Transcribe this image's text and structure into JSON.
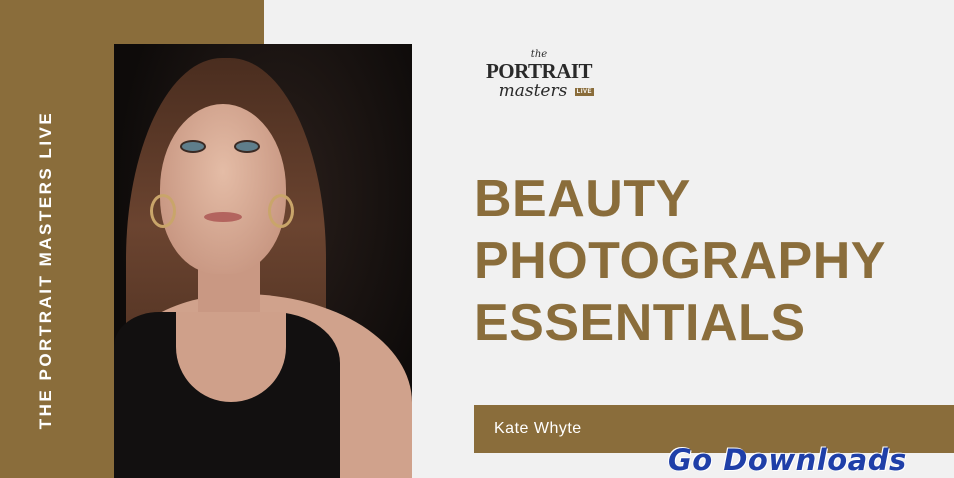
{
  "banner": {
    "vertical_title": "THE PORTRAIT MASTERS LIVE",
    "logo": {
      "the": "the",
      "portrait": "PORTRAIT",
      "masters": "masters",
      "live": "LIVE"
    },
    "headline": [
      "BEAUTY",
      "PHOTOGRAPHY",
      "ESSENTIALS"
    ],
    "instructor": "Kate Whyte",
    "watermark": "Go Downloads"
  },
  "colors": {
    "accent": "#8a6d3b",
    "background": "#f1f1f1",
    "watermark": "#1f3fa8"
  }
}
